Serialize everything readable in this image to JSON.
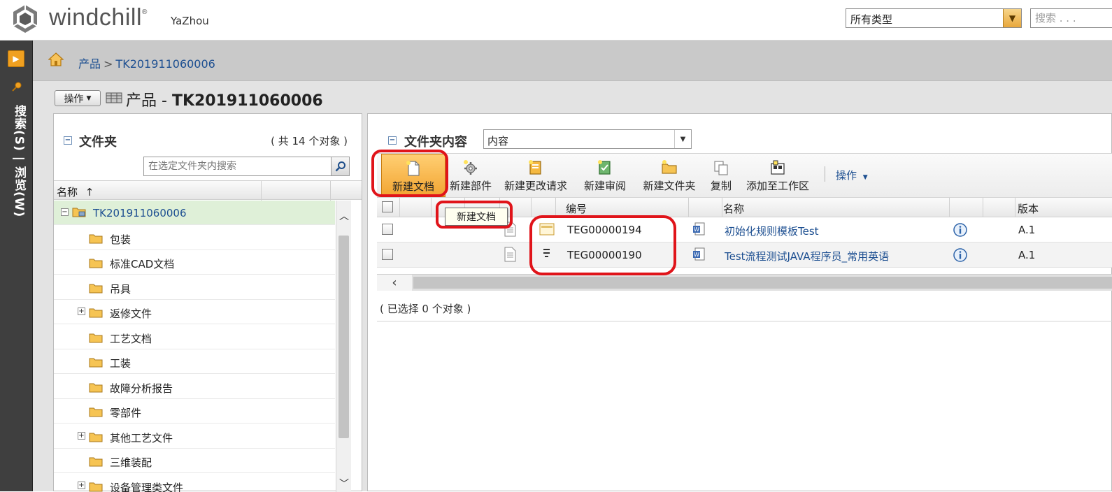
{
  "header": {
    "logo_text": "windchill",
    "logo_mark": "®",
    "user": "YaZhou",
    "type_select_value": "所有类型",
    "search_placeholder": "搜索 . . ."
  },
  "leftnav": {
    "label": "搜索(S) | 浏览(W)"
  },
  "breadcrumb": {
    "root": "产品",
    "separator": ">",
    "current": "TK201911060006"
  },
  "title_row": {
    "actions_label": "操作",
    "title_prefix": "产品 - ",
    "title_name": "TK201911060006"
  },
  "folder_panel": {
    "title": "文件夹",
    "count": "( 共 14 个对象 )",
    "search_placeholder": "在选定文件夹内搜索",
    "column_name": "名称",
    "sort_indicator": "↑",
    "root": "TK201911060006",
    "items": [
      {
        "label": "包装",
        "expandable": false
      },
      {
        "label": "标准CAD文档",
        "expandable": false
      },
      {
        "label": "吊具",
        "expandable": false
      },
      {
        "label": "返修文件",
        "expandable": true
      },
      {
        "label": "工艺文档",
        "expandable": false
      },
      {
        "label": "工装",
        "expandable": false
      },
      {
        "label": "故障分析报告",
        "expandable": false
      },
      {
        "label": "零部件",
        "expandable": false
      },
      {
        "label": "其他工艺文件",
        "expandable": true
      },
      {
        "label": "三维装配",
        "expandable": false
      },
      {
        "label": "设备管理类文件",
        "expandable": true
      }
    ]
  },
  "content_panel": {
    "title": "文件夹内容",
    "view_select_value": "内容",
    "toolbar": {
      "new_document": "新建文档",
      "new_part": "新建部件",
      "new_change_request": "新建更改请求",
      "new_review": "新建审阅",
      "new_folder": "新建文件夹",
      "copy": "复制",
      "add_to_workspace": "添加至工作区",
      "actions": "操作"
    },
    "tooltip": "新建文档",
    "columns": {
      "number": "编号",
      "name": "名称",
      "version": "版本"
    },
    "rows": [
      {
        "number": "TEG00000194",
        "name": "初始化规则模板Test",
        "version": "A.1"
      },
      {
        "number": "TEG00000190",
        "name": "Test流程测试JAVA程序员_常用英语",
        "version": "A.1"
      }
    ],
    "selected_count": "( 已选择 0 个对象 )"
  },
  "colors": {
    "accent_orange": "#f2a431",
    "link_blue": "#1d4f91",
    "annotation_red": "#e0141a",
    "selected_row_green": "#dff0d8"
  }
}
